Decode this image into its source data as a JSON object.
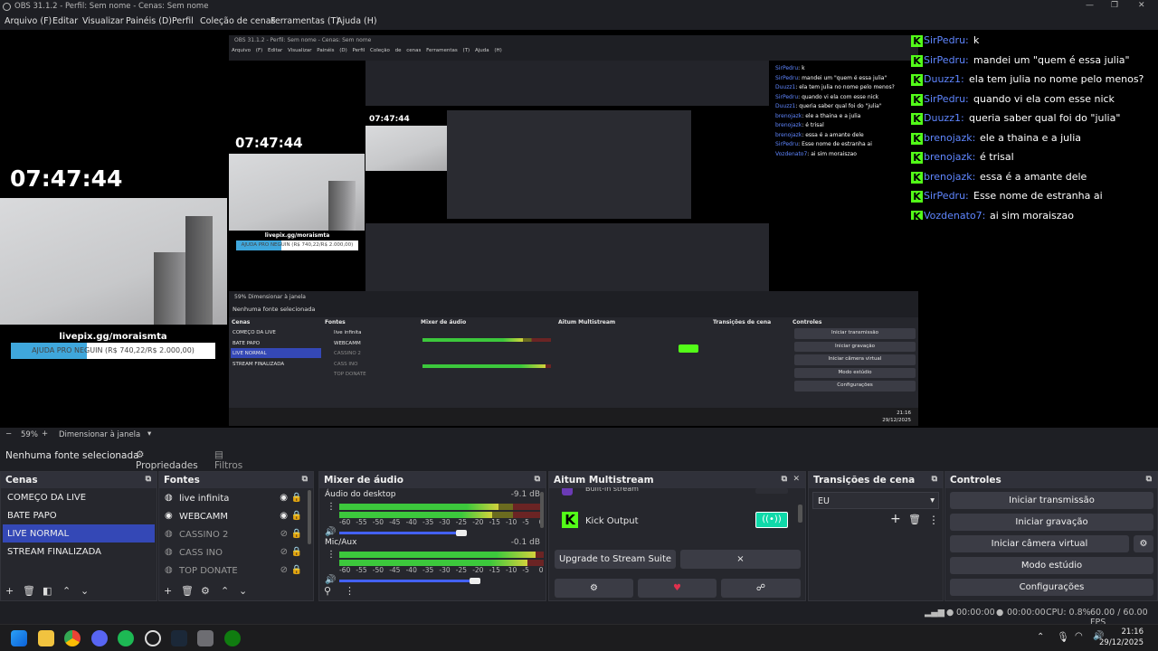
{
  "window": {
    "title": "OBS 31.1.2 - Perfil: Sem nome - Cenas: Sem nome"
  },
  "menu": [
    "Arquivo (F)",
    "Editar",
    "Visualizar",
    "Painéis (D)",
    "Perfil",
    "Coleção de cenas",
    "Ferramentas (T)",
    "Ajuda (H)"
  ],
  "preview": {
    "clock": "07:47:44",
    "livepix": "livepix.gg/moraismta",
    "progress_text": "AJUDA PRO NEGUIN (R$ 740,22/R$ 2.000,00)",
    "progress_value": 0.37
  },
  "chat": [
    {
      "user": "SirPedru",
      "text": "k"
    },
    {
      "user": "SirPedru",
      "text": "mandei um \"quem é essa julia\""
    },
    {
      "user": "Duuzz1",
      "text": "ela tem julia no nome pelo menos?"
    },
    {
      "user": "SirPedru",
      "text": "quando vi ela com esse nick"
    },
    {
      "user": "Duuzz1",
      "text": "queria saber qual foi do \"julia\""
    },
    {
      "user": "brenojazk",
      "text": "ele a thaina e a julia"
    },
    {
      "user": "brenojazk",
      "text": "é trisal"
    },
    {
      "user": "brenojazk",
      "text": "essa é a amante dele"
    },
    {
      "user": "SirPedru",
      "text": "Esse nome de estranha ai"
    },
    {
      "user": "Vozdenato7",
      "text": "ai sim moraiszao"
    }
  ],
  "nested": {
    "title": "OBS 31.1.2 - Perfil: Sem nome - Cenas: Sem nome",
    "zoom": "59%",
    "resize": "Dimensionar à janela",
    "taskbar_time": "21:16",
    "taskbar_date": "29/12/2025"
  },
  "zoombar": {
    "zoom": "59%",
    "resize": "Dimensionar à janela"
  },
  "sourcebar": {
    "no_source": "Nenhuma fonte selecionada",
    "properties": "Propriedades",
    "filters": "Filtros"
  },
  "scenes": {
    "title": "Cenas",
    "items": [
      "COMEÇO DA LIVE",
      "BATE PAPO",
      "LIVE NORMAL",
      "STREAM FINALIZADA"
    ],
    "selected": 2
  },
  "sources": {
    "title": "Fontes",
    "items": [
      {
        "name": "live infinita",
        "icon": "globe-icon",
        "visible": true,
        "enabled": true
      },
      {
        "name": "WEBCAMM",
        "icon": "camera-icon",
        "visible": true,
        "enabled": true
      },
      {
        "name": "CASSINO 2",
        "icon": "globe-icon",
        "visible": false,
        "enabled": false
      },
      {
        "name": "CASS INO",
        "icon": "globe-icon",
        "visible": false,
        "enabled": false
      },
      {
        "name": "TOP DONATE",
        "icon": "globe-icon",
        "visible": false,
        "enabled": false
      }
    ]
  },
  "mixer": {
    "title": "Mixer de áudio",
    "channels": [
      {
        "name": "Áudio do desktop",
        "db": "-9.1 dB",
        "level": 0.78,
        "volume": 0.9
      },
      {
        "name": "Mic/Aux",
        "db": "-0.1 dB",
        "level": 0.96,
        "volume": 1.0
      }
    ],
    "scale": [
      "-60",
      "-55",
      "-50",
      "-45",
      "-40",
      "-35",
      "-30",
      "-25",
      "-20",
      "-15",
      "-10",
      "-5",
      "0"
    ]
  },
  "multistream": {
    "title": "Aitum Multistream",
    "builtin": "Built-in stream",
    "kick": "Kick Output",
    "upgrade": "Upgrade to Stream Suite",
    "close": "×"
  },
  "transitions": {
    "title": "Transições de cena",
    "selected": "EU"
  },
  "controls": {
    "title": "Controles",
    "buttons": [
      "Iniciar transmissão",
      "Iniciar gravação",
      "Iniciar câmera virtual",
      "Modo estúdio",
      "Configurações"
    ]
  },
  "status": {
    "time1": "00:00:00",
    "time2": "00:00:00",
    "cpu": "CPU: 0.8%",
    "fps": "60.00 / 60.00 FPS"
  },
  "taskbar": {
    "time": "21:16",
    "date": "29/12/2025"
  },
  "colors": {
    "accent": "#3448b6",
    "kick": "#53fc18",
    "chat_user": "#5f86ff"
  }
}
